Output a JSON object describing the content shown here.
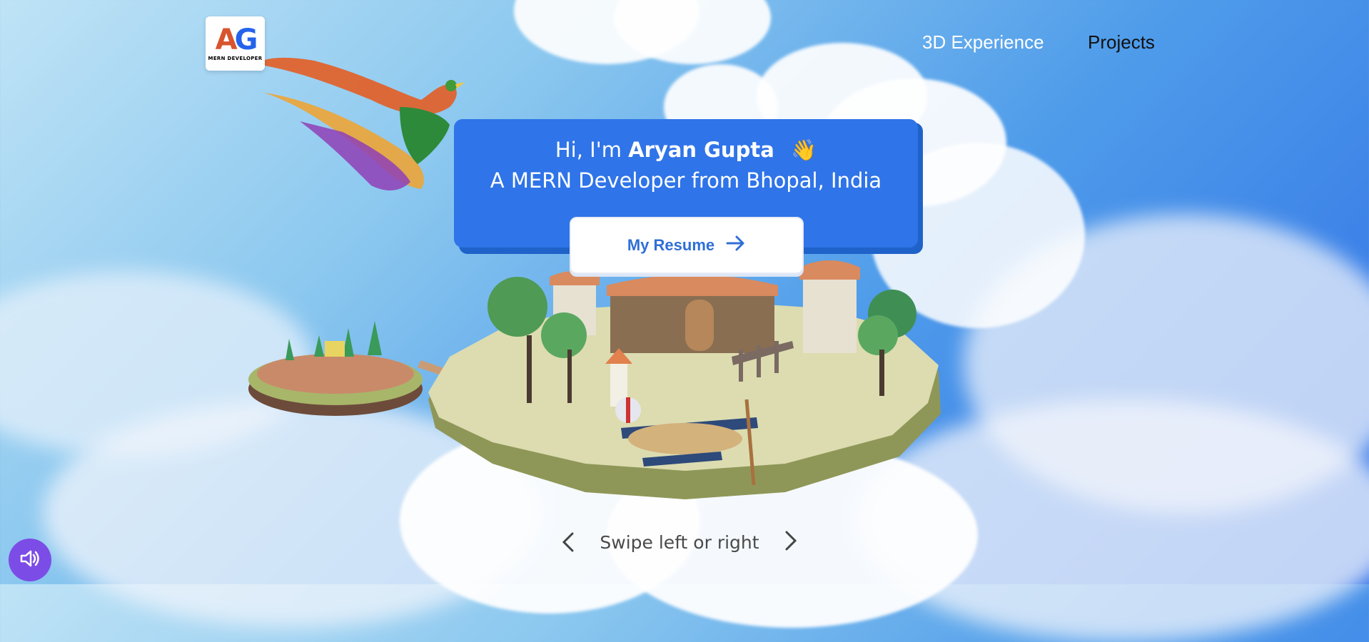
{
  "header": {
    "logo": {
      "mark_letters": "AG",
      "subtitle": "MERN DEVELOPER"
    },
    "nav": [
      {
        "label": "3D Experience"
      },
      {
        "label": "Projects"
      }
    ]
  },
  "hero": {
    "greeting_prefix": "Hi, I'm ",
    "name": "Aryan Gupta",
    "emoji": "👋",
    "tagline": "A MERN Developer from Bhopal, India",
    "cta_label": "My Resume"
  },
  "controls": {
    "swipe_hint": "Swipe left or right",
    "sound_button": "speaker-icon"
  },
  "colors": {
    "card": "#2f74e8",
    "cta_text": "#2f6fd6",
    "sound_button": "#7c4ce6"
  }
}
